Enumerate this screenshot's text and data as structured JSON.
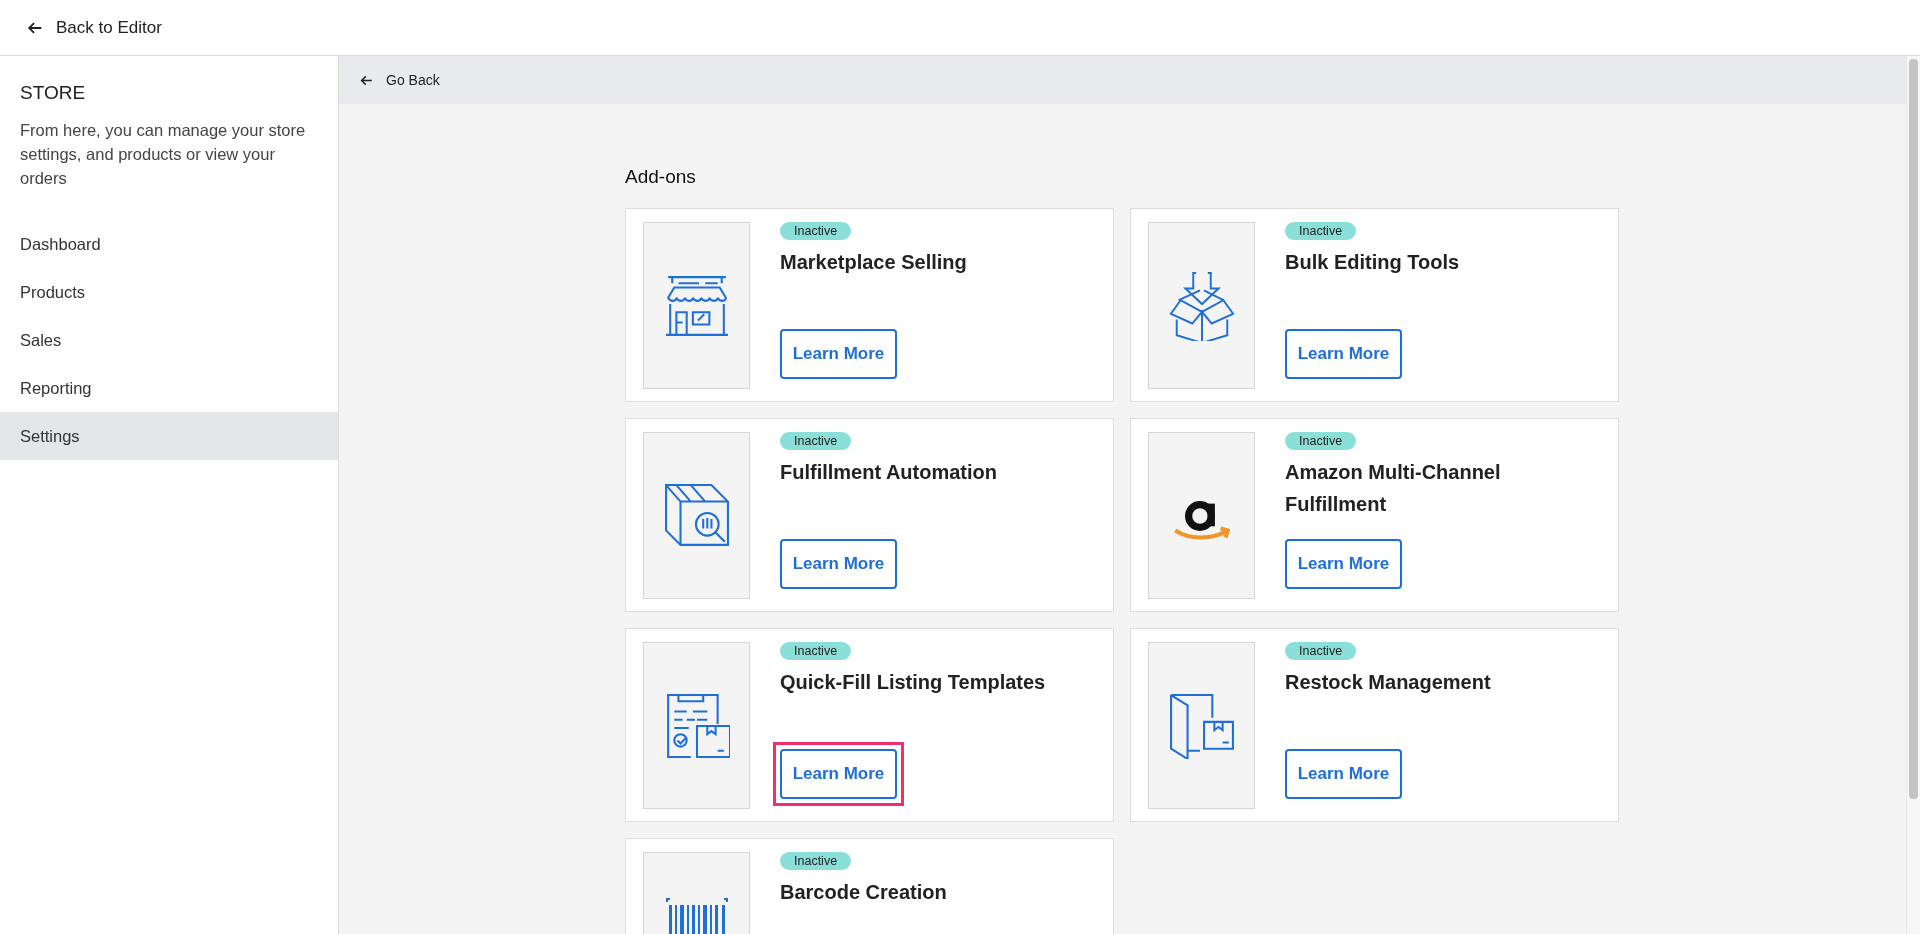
{
  "top_bar": {
    "back_link": "Back to Editor"
  },
  "sidebar": {
    "title": "STORE",
    "description": "From here, you can manage your store settings, and products or view your orders",
    "items": [
      {
        "label": "Dashboard",
        "selected": false
      },
      {
        "label": "Products",
        "selected": false
      },
      {
        "label": "Sales",
        "selected": false
      },
      {
        "label": "Reporting",
        "selected": false
      },
      {
        "label": "Settings",
        "selected": true
      }
    ]
  },
  "sub_bar": {
    "back_link": "Go Back"
  },
  "heading": "Add-ons",
  "addons": [
    {
      "kind": "store",
      "status": "Inactive",
      "title": "Marketplace Selling",
      "button": "Learn More",
      "highlighted": false
    },
    {
      "kind": "download",
      "status": "Inactive",
      "title": "Bulk Editing Tools",
      "button": "Learn More",
      "highlighted": false
    },
    {
      "kind": "inspect",
      "status": "Inactive",
      "title": "Fulfillment Automation",
      "button": "Learn More",
      "highlighted": false
    },
    {
      "kind": "logo",
      "status": "Inactive",
      "title": "Amazon Multi-Channel Fulfillment",
      "button": "Learn More",
      "highlighted": false
    },
    {
      "kind": "template",
      "status": "Inactive",
      "title": "Quick-Fill Listing Templates",
      "button": "Learn More",
      "highlighted": true
    },
    {
      "kind": "restock",
      "status": "Inactive",
      "title": "Restock Management",
      "button": "Learn More",
      "highlighted": false
    },
    {
      "kind": "barcode",
      "status": "Inactive",
      "title": "Barcode Creation"
    }
  ]
}
